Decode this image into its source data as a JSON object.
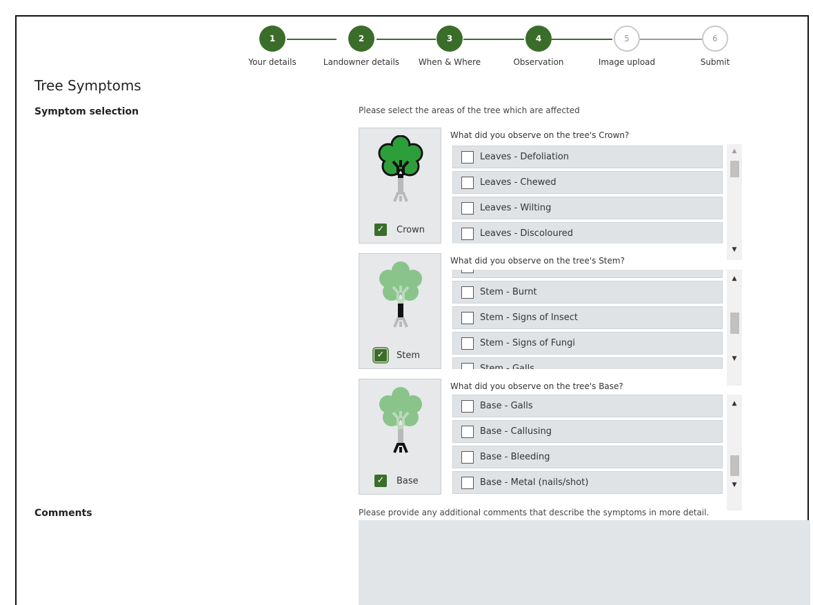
{
  "stepper": {
    "steps": [
      {
        "number": "1",
        "label": "Your details",
        "state": "done"
      },
      {
        "number": "2",
        "label": "Landowner details",
        "state": "done"
      },
      {
        "number": "3",
        "label": "When & Where",
        "state": "done"
      },
      {
        "number": "4",
        "label": "Observation",
        "state": "done"
      },
      {
        "number": "5",
        "label": "Image upload",
        "state": "todo"
      },
      {
        "number": "6",
        "label": "Submit",
        "state": "todo"
      }
    ]
  },
  "page": {
    "title": "Tree Symptoms",
    "symptom_label": "Symptom selection",
    "symptom_hint": "Please select the areas of the tree which are affected",
    "comments_label": "Comments",
    "comments_hint": "Please provide any additional comments that describe the symptoms in more detail."
  },
  "parts": {
    "crown": {
      "label": "Crown",
      "checked": true,
      "question": "What did you observe on the tree's Crown?",
      "options": [
        "Leaves - Defoliation",
        "Leaves - Chewed",
        "Leaves - Wilting",
        "Leaves - Discoloured"
      ]
    },
    "stem": {
      "label": "Stem",
      "checked": true,
      "question": "What did you observe on the tree's Stem?",
      "options": [
        "",
        "Stem - Burnt",
        "Stem - Signs of Insect",
        "Stem - Signs of Fungi",
        "Stem - Galls"
      ]
    },
    "base": {
      "label": "Base",
      "checked": true,
      "question": "What did you observe on the tree's Base?",
      "options": [
        "Base - Galls",
        "Base - Callusing",
        "Base - Bleeding",
        "Base - Metal (nails/shot)"
      ]
    }
  },
  "icons": {
    "check": "✓",
    "scroll_up": "▲",
    "scroll_down": "▼"
  },
  "colors": {
    "accent": "#3b6d2a",
    "tree_active": "#2e9e3b",
    "tree_inactive": "#8ac48b",
    "panel_bg": "#e6e8ea",
    "item_bg": "#dfe3e6"
  }
}
